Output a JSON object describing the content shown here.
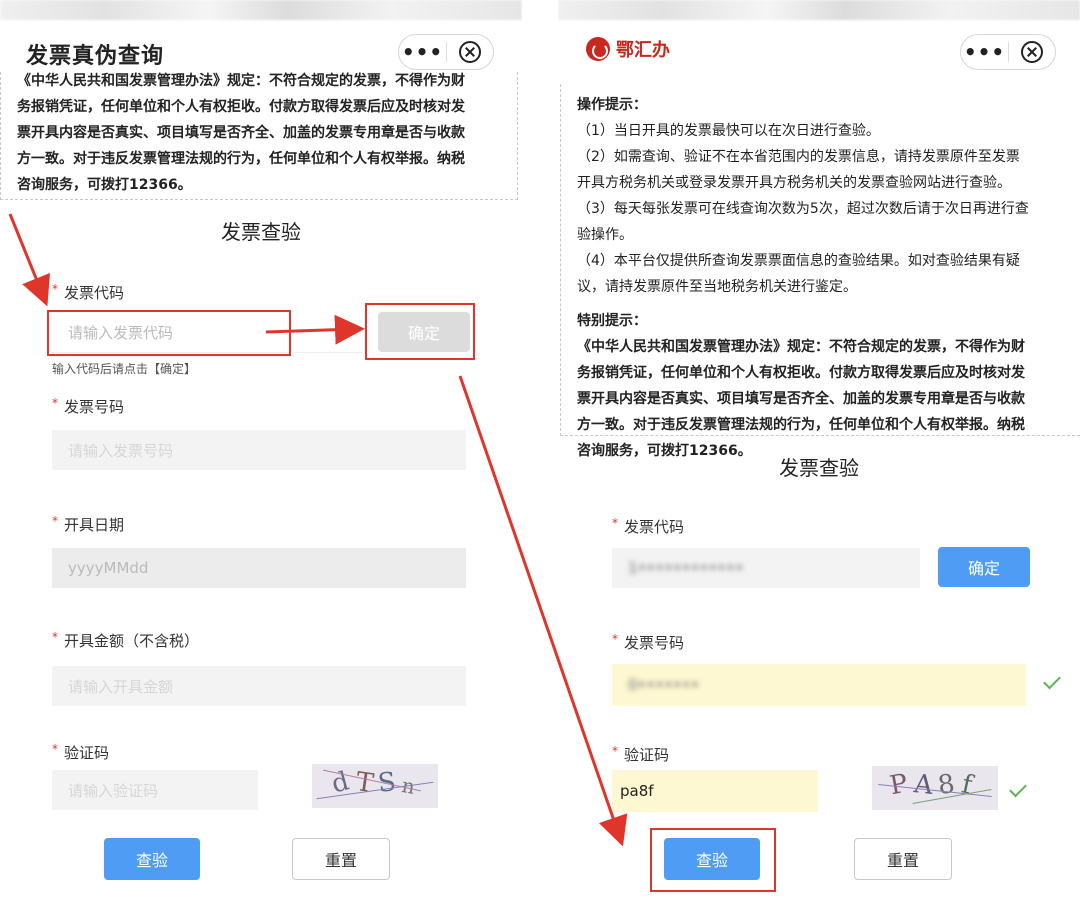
{
  "left": {
    "header": {
      "title": "发票真伪查询"
    },
    "notice_lines": [
      "《中华人民共和国发票管理办法》规定：不符合规定的发票，不得作为财",
      "务报销凭证，任何单位和个人有权拒收。付款方取得发票后应及时核对发",
      "票开具内容是否真实、项目填写是否齐全、加盖的发票专用章是否与收款",
      "方一致。对于违反发票管理法规的行为，任何单位和个人有权举报。纳税",
      "咨询服务，可拨打12366。"
    ],
    "section_title": "发票查验",
    "form": {
      "code_label": "发票代码",
      "code_placeholder": "请输入发票代码",
      "confirm_label": "确定",
      "code_hint": "输入代码后请点击【确定】",
      "number_label": "发票号码",
      "number_placeholder": "请输入发票号码",
      "date_label": "开具日期",
      "date_placeholder": "yyyyMMdd",
      "amount_label": "开具金额（不含税）",
      "amount_placeholder": "请输入开具金额",
      "captcha_label": "验证码",
      "captcha_placeholder": "请输入验证码",
      "captcha_chars": [
        "d",
        "T",
        "S",
        "n"
      ],
      "submit_label": "查验",
      "reset_label": "重置"
    }
  },
  "right": {
    "header": {
      "logo_text": "鄂汇办"
    },
    "tips_heading": "操作提示：",
    "tips": [
      "（1）当日开具的发票最快可以在次日进行查验。",
      "（2）如需查询、验证不在本省范围内的发票信息，请持发票原件至发票",
      "开具方税务机关或登录发票开具方税务机关的发票查验网站进行查验。",
      "（3）每天每张发票可在线查询次数为5次，超过次数后请于次日再进行查",
      "验操作。",
      "（4）本平台仅提供所查询发票票面信息的查验结果。如对查验结果有疑",
      "议，请持发票原件至当地税务机关进行鉴定。"
    ],
    "special_heading": "特别提示：",
    "special_lines": [
      "《中华人民共和国发票管理办法》规定：不符合规定的发票，不得作为财",
      "务报销凭证，任何单位和个人有权拒收。付款方取得发票后应及时核对发",
      "票开具内容是否真实、项目填写是否齐全、加盖的发票专用章是否与收款",
      "方一致。对于违反发票管理法规的行为，任何单位和个人有权举报。纳税",
      "咨询服务，可拨打12366。"
    ],
    "section_title": "发票查验",
    "form": {
      "code_label": "发票代码",
      "code_value": "1••••••••••••",
      "confirm_label": "确定",
      "number_label": "发票号码",
      "number_value": "0•••••••",
      "captcha_label": "验证码",
      "captcha_value": "pa8f",
      "captcha_chars": [
        "P",
        "A",
        "8",
        "f"
      ],
      "submit_label": "查验",
      "reset_label": "重置"
    }
  },
  "colors": {
    "primary": "#4e9cf3",
    "annotation_red": "#e0352b",
    "required_star": "#e83030",
    "valid_check": "#5fb455",
    "autofill_yellow": "#fdf8d2",
    "logo_red": "#c8281e"
  },
  "icons": [
    "more-dots-icon",
    "close-circle-icon",
    "logo-icon",
    "check-icon",
    "red-arrow-icon"
  ]
}
